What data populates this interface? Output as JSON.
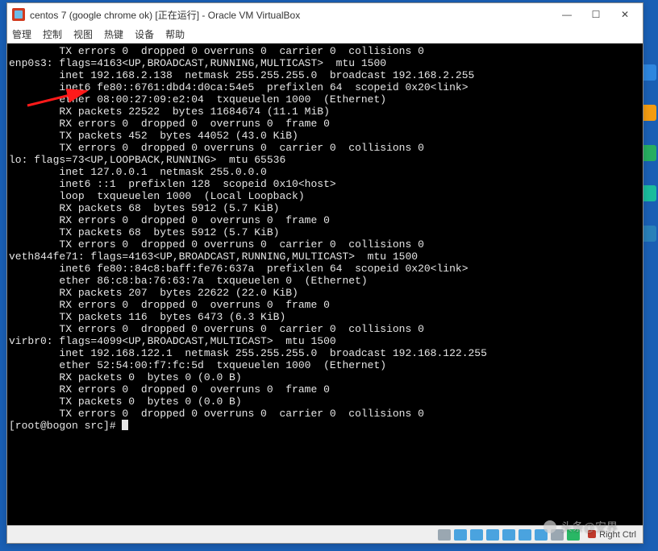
{
  "window": {
    "title": "centos 7 (google chrome ok) [正在运行] - Oracle VM VirtualBox",
    "controls": {
      "minimize": "—",
      "maximize": "☐",
      "close": "✕"
    }
  },
  "menubar": {
    "items": [
      "管理",
      "控制",
      "视图",
      "热键",
      "设备",
      "帮助"
    ]
  },
  "terminal": {
    "lines": [
      "        TX errors 0  dropped 0 overruns 0  carrier 0  collisions 0",
      "",
      "enp0s3: flags=4163<UP,BROADCAST,RUNNING,MULTICAST>  mtu 1500",
      "        inet 192.168.2.138  netmask 255.255.255.0  broadcast 192.168.2.255",
      "        inet6 fe80::6761:dbd4:d0ca:54e5  prefixlen 64  scopeid 0x20<link>",
      "        ether 08:00:27:09:e2:04  txqueuelen 1000  (Ethernet)",
      "        RX packets 22522  bytes 11684674 (11.1 MiB)",
      "        RX errors 0  dropped 0  overruns 0  frame 0",
      "        TX packets 452  bytes 44052 (43.0 KiB)",
      "        TX errors 0  dropped 0 overruns 0  carrier 0  collisions 0",
      "",
      "lo: flags=73<UP,LOOPBACK,RUNNING>  mtu 65536",
      "        inet 127.0.0.1  netmask 255.0.0.0",
      "        inet6 ::1  prefixlen 128  scopeid 0x10<host>",
      "        loop  txqueuelen 1000  (Local Loopback)",
      "        RX packets 68  bytes 5912 (5.7 KiB)",
      "        RX errors 0  dropped 0  overruns 0  frame 0",
      "        TX packets 68  bytes 5912 (5.7 KiB)",
      "        TX errors 0  dropped 0 overruns 0  carrier 0  collisions 0",
      "",
      "veth844fe71: flags=4163<UP,BROADCAST,RUNNING,MULTICAST>  mtu 1500",
      "        inet6 fe80::84c8:baff:fe76:637a  prefixlen 64  scopeid 0x20<link>",
      "        ether 86:c8:ba:76:63:7a  txqueuelen 0  (Ethernet)",
      "        RX packets 207  bytes 22622 (22.0 KiB)",
      "        RX errors 0  dropped 0  overruns 0  frame 0",
      "        TX packets 116  bytes 6473 (6.3 KiB)",
      "        TX errors 0  dropped 0 overruns 0  carrier 0  collisions 0",
      "",
      "virbr0: flags=4099<UP,BROADCAST,MULTICAST>  mtu 1500",
      "        inet 192.168.122.1  netmask 255.255.255.0  broadcast 192.168.122.255",
      "        ether 52:54:00:f7:fc:5d  txqueuelen 1000  (Ethernet)",
      "        RX packets 0  bytes 0 (0.0 B)",
      "        RX errors 0  dropped 0  overruns 0  frame 0",
      "        TX packets 0  bytes 0 (0.0 B)",
      "        TX errors 0  dropped 0 overruns 0  carrier 0  collisions 0",
      "",
      "[root@bogon src]# "
    ]
  },
  "statusbar": {
    "host_key": "Right Ctrl"
  },
  "watermark": "头条@安界"
}
